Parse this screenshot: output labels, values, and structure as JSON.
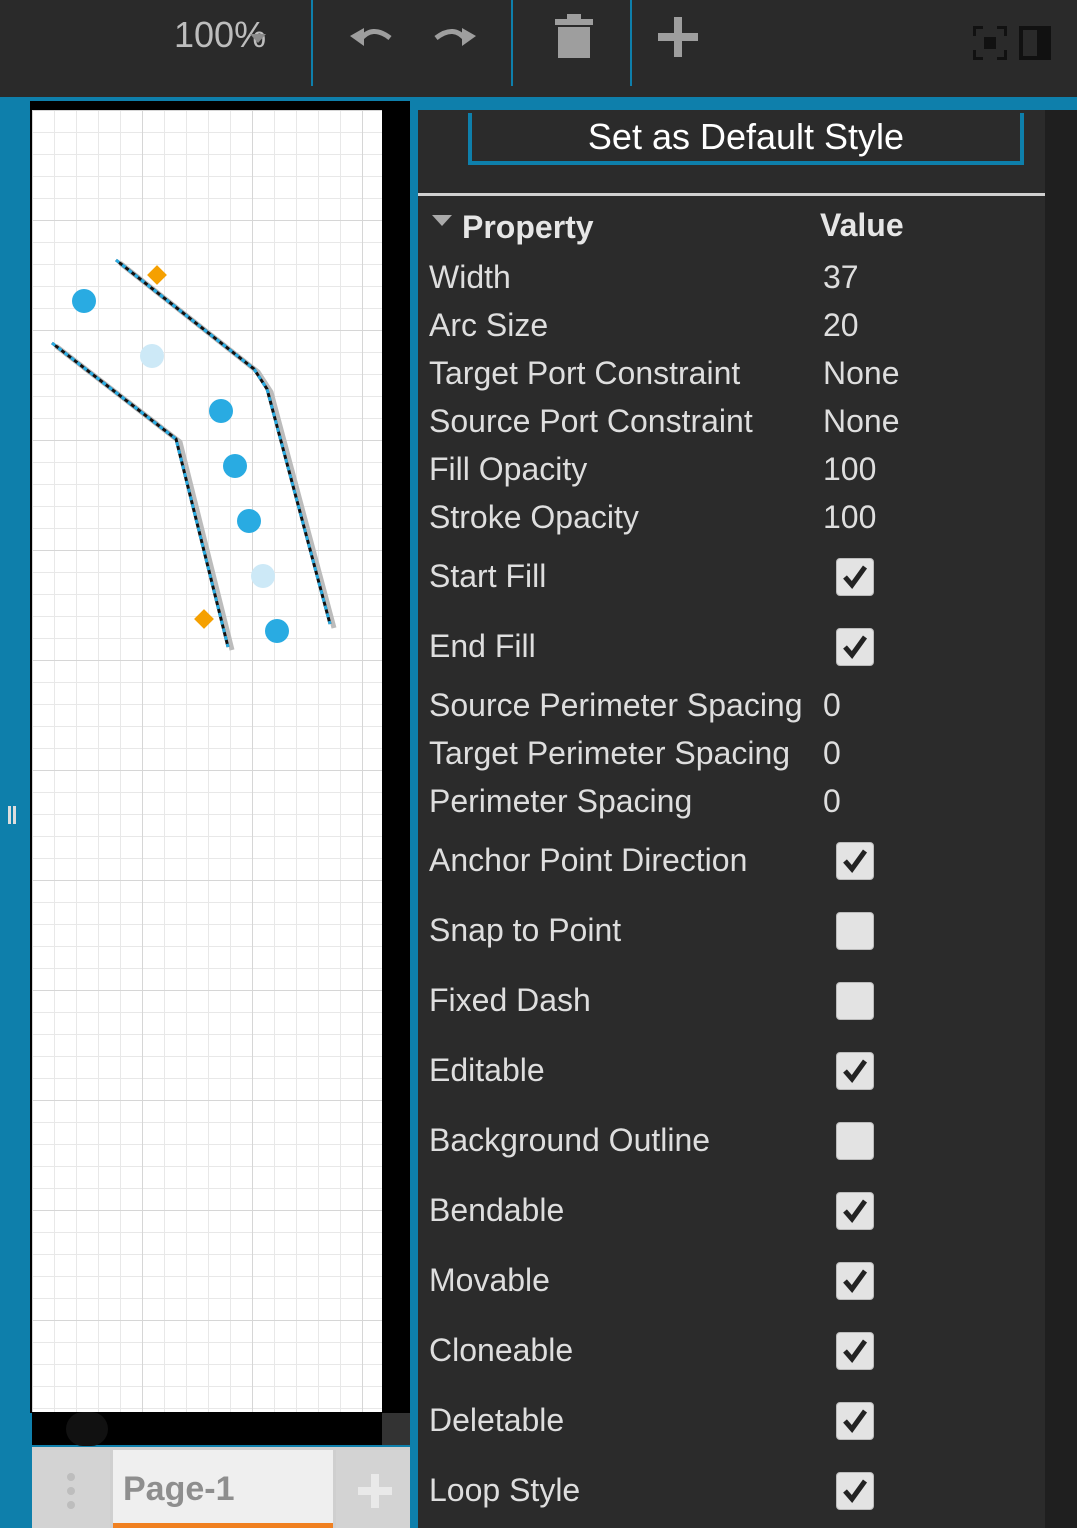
{
  "toolbar": {
    "zoom_label": "100%",
    "icons": [
      "undo-icon",
      "redo-icon",
      "delete-icon",
      "add-icon",
      "fullscreen-icon",
      "panel-toggle-icon"
    ]
  },
  "panel": {
    "default_style_button": "Set as Default Style",
    "header_property": "Property",
    "header_value": "Value",
    "rows": [
      {
        "label": "Width",
        "value": "37"
      },
      {
        "label": "Arc Size",
        "value": "20"
      },
      {
        "label": "Target Port Constraint",
        "value": "None"
      },
      {
        "label": "Source Port Constraint",
        "value": "None"
      },
      {
        "label": "Fill Opacity",
        "value": "100"
      },
      {
        "label": "Stroke Opacity",
        "value": "100"
      },
      {
        "label": "Start Fill",
        "checked": true
      },
      {
        "label": "End Fill",
        "checked": true
      },
      {
        "label": "Source Perimeter Spacing",
        "value": "0"
      },
      {
        "label": "Target Perimeter Spacing",
        "value": "0"
      },
      {
        "label": "Perimeter Spacing",
        "value": "0"
      },
      {
        "label": "Anchor Point Direction",
        "checked": true
      },
      {
        "label": "Snap to Point",
        "checked": false
      },
      {
        "label": "Fixed Dash",
        "checked": false
      },
      {
        "label": "Editable",
        "checked": true
      },
      {
        "label": "Background Outline",
        "checked": false
      },
      {
        "label": "Bendable",
        "checked": true
      },
      {
        "label": "Movable",
        "checked": true
      },
      {
        "label": "Cloneable",
        "checked": true
      },
      {
        "label": "Deletable",
        "checked": true
      },
      {
        "label": "Loop Style",
        "checked": true
      }
    ]
  },
  "tabs": {
    "page_label": "Page-1"
  },
  "colors": {
    "accent": "#0e7fab",
    "toolbar_bg": "#2a2a2a",
    "panel_bg": "#2b2b2b",
    "handle_blue": "#29abe2",
    "handle_orange": "#f5a000",
    "tab_active": "#f08020"
  }
}
